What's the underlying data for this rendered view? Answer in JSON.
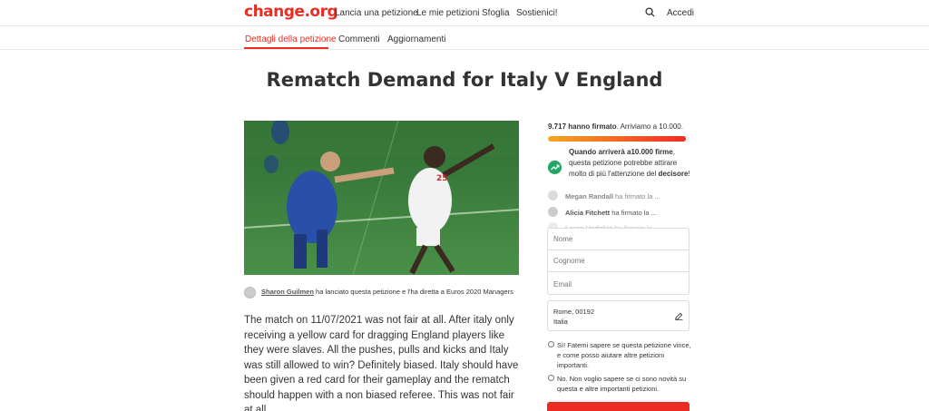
{
  "header": {
    "logo": "change.org",
    "nav": [
      "Lancia una petizione",
      "Le mie petizioni",
      "Sfoglia",
      "Sostienici!"
    ],
    "login": "Accedi",
    "search_icon": "search-icon"
  },
  "tabs": [
    "Dettagli della petizione",
    "Commenti",
    "Aggiornamenti"
  ],
  "petition": {
    "title": "Rematch Demand for Italy V England",
    "starter_name": "Sharon Guilmen",
    "starter_text": " ha lanciato questa petizione e l'ha diretta a Euros 2020 Managers",
    "body": "The match on 11/07/2021 was not fair at all. After italy only receiving a yellow card for dragging England players like they were slaves. All the pushes, pulls and kicks and Italy was still allowed to win? Definitely biased. Italy should have been given a red card for their gameplay and the rematch should happen with a non biased referee. This was not fair at all."
  },
  "sidebar": {
    "signed_count": "9.717 hanno firmato",
    "goal_text": ". Arriviamo a 10.000.",
    "progress": 0.9717,
    "milestone_bold": "Quando arriverà a10.000 firme",
    "milestone_text": ", questa petizione potrebbe attirare molto di più l'attenzione del ",
    "milestone_bold_2": "decisore",
    "milestone_end": "!",
    "signers": [
      {
        "name": "Megan Randall",
        "action": " ha firmato la ..."
      },
      {
        "name": "Alicia Fitchett",
        "action": " ha firmato la ..."
      },
      {
        "name": "Laura Hodgkin",
        "action": " ha firmato la ..."
      }
    ],
    "form": {
      "first_name_placeholder": "Nome",
      "last_name_placeholder": "Cognome",
      "email_placeholder": "Email"
    },
    "location_line1": "Rome, 00192",
    "location_line2": "Italia",
    "opt_in": "Sì! Fatemi sapere se questa petizione vince, e come posso aiutare altre petizioni importanti.",
    "opt_out": "No. Non voglio sapere se ci sono novità su questa e altre importanti petizioni."
  },
  "colors": {
    "brand": "#ec2c22",
    "progress_start": "#f5a623",
    "success": "#22a866"
  }
}
